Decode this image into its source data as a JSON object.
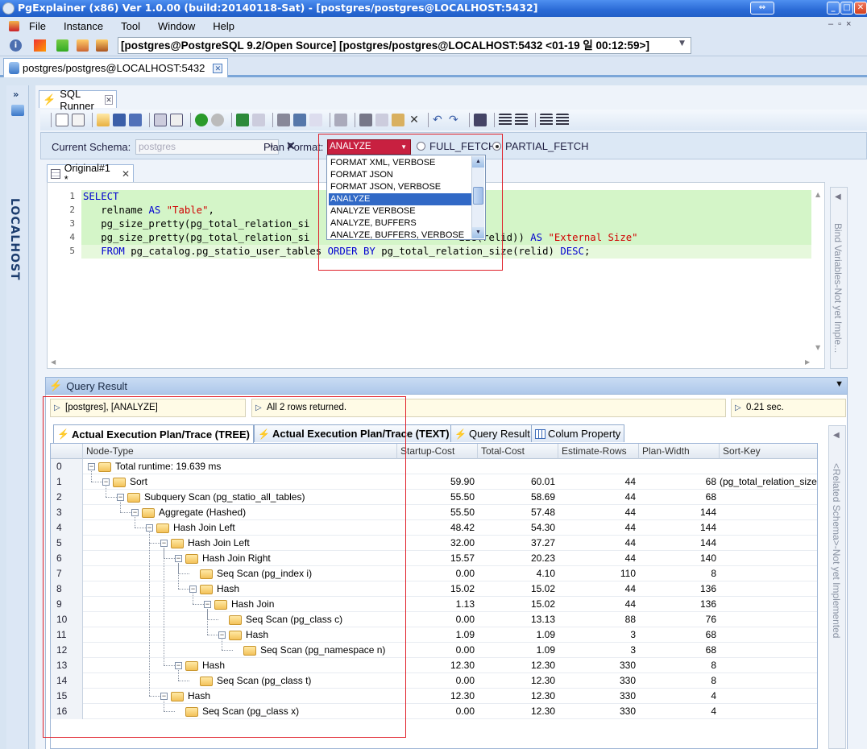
{
  "window": {
    "title": "PgExplainer (x86) Ver 1.0.00 (build:20140118-Sat) - [postgres/postgres@LOCALHOST:5432]"
  },
  "menu": [
    "File",
    "Instance",
    "Tool",
    "Window",
    "Help"
  ],
  "connection": {
    "label": "[postgres@PostgreSQL 9.2/Open Source] [postgres/postgres@LOCALHOST:5432 <01-19 일 00:12:59>]"
  },
  "document_tab": {
    "label": "postgres/postgres@LOCALHOST:5432"
  },
  "sidebar": {
    "label": "LOCALHOST",
    "toggle": "»"
  },
  "sql_runner": {
    "tab_label": "SQL Runner"
  },
  "schema": {
    "current_schema_label": "Current Schema:",
    "current_schema_value": "postgres",
    "plan_format_label": "Plan Format:",
    "plan_format_value": "ANALYZE",
    "full_fetch_label": "FULL_FETCH",
    "partial_fetch_label": "PARTIAL_FETCH",
    "selected_fetch": "PARTIAL_FETCH"
  },
  "plan_format_options": [
    "FORMAT XML, VERBOSE",
    "FORMAT JSON",
    "FORMAT JSON, VERBOSE",
    "ANALYZE",
    "ANALYZE VERBOSE",
    "ANALYZE, BUFFERS",
    "ANALYZE, BUFFERS, VERBOSE"
  ],
  "plan_format_selected_index": 3,
  "editor": {
    "tab_label": "Original#1 *",
    "line_numbers": [
      "1",
      "2",
      "3",
      "4",
      "5"
    ],
    "lines": [
      [
        {
          "t": "SELECT",
          "c": "kw"
        }
      ],
      [
        {
          "t": "   relname ",
          "c": ""
        },
        {
          "t": "AS",
          "c": "kw"
        },
        {
          "t": " ",
          "c": ""
        },
        {
          "t": "\"Table\"",
          "c": "str"
        },
        {
          "t": ",",
          "c": ""
        }
      ],
      [
        {
          "t": "   pg_size_pretty(pg_total_relation_si",
          "c": ""
        }
      ],
      [
        {
          "t": "   pg_size_pretty(pg_total_relation_si",
          "c": ""
        },
        {
          "t": "                         ",
          "c": ""
        },
        {
          "t": "ize(relid)) ",
          "c": ""
        },
        {
          "t": "AS",
          "c": "kw"
        },
        {
          "t": " ",
          "c": ""
        },
        {
          "t": "\"External Size\"",
          "c": "str"
        }
      ],
      [
        {
          "t": "   ",
          "c": ""
        },
        {
          "t": "FROM",
          "c": "kw"
        },
        {
          "t": " pg_catalog.pg_statio_user_tables ",
          "c": ""
        },
        {
          "t": "ORDER BY",
          "c": "kw"
        },
        {
          "t": " pg_total_relation_size(relid) ",
          "c": ""
        },
        {
          "t": "DESC",
          "c": "kw"
        },
        {
          "t": ";",
          "c": ""
        }
      ]
    ]
  },
  "bind_panel": {
    "label": "Bind Variables-Not yet Imple..."
  },
  "query_result": {
    "header": "Query Result",
    "status_conn": "[postgres], [ANALYZE]",
    "status_rows": "All 2 rows returned.",
    "status_time": "0.21 sec.",
    "tabs": [
      "Actual Execution Plan/Trace (TREE)",
      "Actual Execution Plan/Trace (TEXT)",
      "Query Result",
      "Colum Property"
    ],
    "columns": [
      "Node-Type",
      "Startup-Cost",
      "Total-Cost",
      "Estimate-Rows",
      "Plan-Width",
      "Sort-Key"
    ],
    "rows": [
      {
        "n": "0",
        "d": 0,
        "exp": true,
        "node": "Total runtime: 19.639 ms",
        "sc": "",
        "tc": "",
        "er": "",
        "pw": "",
        "sk": ""
      },
      {
        "n": "1",
        "d": 1,
        "exp": true,
        "node": "Sort",
        "sc": "59.90",
        "tc": "60.01",
        "er": "44",
        "pw": "68",
        "sk": "(pg_total_relation_size((p"
      },
      {
        "n": "2",
        "d": 2,
        "exp": true,
        "node": "Subquery Scan (pg_statio_all_tables)",
        "sc": "55.50",
        "tc": "58.69",
        "er": "44",
        "pw": "68",
        "sk": ""
      },
      {
        "n": "3",
        "d": 3,
        "exp": true,
        "node": "Aggregate (Hashed)",
        "sc": "55.50",
        "tc": "57.48",
        "er": "44",
        "pw": "144",
        "sk": ""
      },
      {
        "n": "4",
        "d": 4,
        "exp": true,
        "node": "Hash Join Left",
        "sc": "48.42",
        "tc": "54.30",
        "er": "44",
        "pw": "144",
        "sk": ""
      },
      {
        "n": "5",
        "d": 5,
        "exp": true,
        "node": "Hash Join Left",
        "sc": "32.00",
        "tc": "37.27",
        "er": "44",
        "pw": "144",
        "sk": ""
      },
      {
        "n": "6",
        "d": 6,
        "exp": true,
        "node": "Hash Join Right",
        "sc": "15.57",
        "tc": "20.23",
        "er": "44",
        "pw": "140",
        "sk": ""
      },
      {
        "n": "7",
        "d": 7,
        "exp": false,
        "node": "Seq Scan (pg_index i)",
        "sc": "0.00",
        "tc": "4.10",
        "er": "110",
        "pw": "8",
        "sk": ""
      },
      {
        "n": "8",
        "d": 7,
        "exp": true,
        "node": "Hash",
        "sc": "15.02",
        "tc": "15.02",
        "er": "44",
        "pw": "136",
        "sk": ""
      },
      {
        "n": "9",
        "d": 8,
        "exp": true,
        "node": "Hash Join",
        "sc": "1.13",
        "tc": "15.02",
        "er": "44",
        "pw": "136",
        "sk": ""
      },
      {
        "n": "10",
        "d": 9,
        "exp": false,
        "node": "Seq Scan (pg_class c)",
        "sc": "0.00",
        "tc": "13.13",
        "er": "88",
        "pw": "76",
        "sk": ""
      },
      {
        "n": "11",
        "d": 9,
        "exp": true,
        "node": "Hash",
        "sc": "1.09",
        "tc": "1.09",
        "er": "3",
        "pw": "68",
        "sk": ""
      },
      {
        "n": "12",
        "d": 10,
        "exp": false,
        "node": "Seq Scan (pg_namespace n)",
        "sc": "0.00",
        "tc": "1.09",
        "er": "3",
        "pw": "68",
        "sk": ""
      },
      {
        "n": "13",
        "d": 6,
        "exp": true,
        "node": "Hash",
        "sc": "12.30",
        "tc": "12.30",
        "er": "330",
        "pw": "8",
        "sk": ""
      },
      {
        "n": "14",
        "d": 7,
        "exp": false,
        "node": "Seq Scan (pg_class t)",
        "sc": "0.00",
        "tc": "12.30",
        "er": "330",
        "pw": "8",
        "sk": ""
      },
      {
        "n": "15",
        "d": 5,
        "exp": true,
        "node": "Hash",
        "sc": "12.30",
        "tc": "12.30",
        "er": "330",
        "pw": "4",
        "sk": ""
      },
      {
        "n": "16",
        "d": 6,
        "exp": false,
        "node": "Seq Scan (pg_class x)",
        "sc": "0.00",
        "tc": "12.30",
        "er": "330",
        "pw": "4",
        "sk": ""
      }
    ]
  },
  "related_panel": {
    "label": "<Related Schema>-Not yet Implemented"
  },
  "colors": {
    "title_bar": "#2a6ad6",
    "selection": "#3169c6",
    "highlight_red": "#e0202a",
    "plan_format_bg": "#c82040",
    "editor_highlight": "#d4f5c8"
  }
}
